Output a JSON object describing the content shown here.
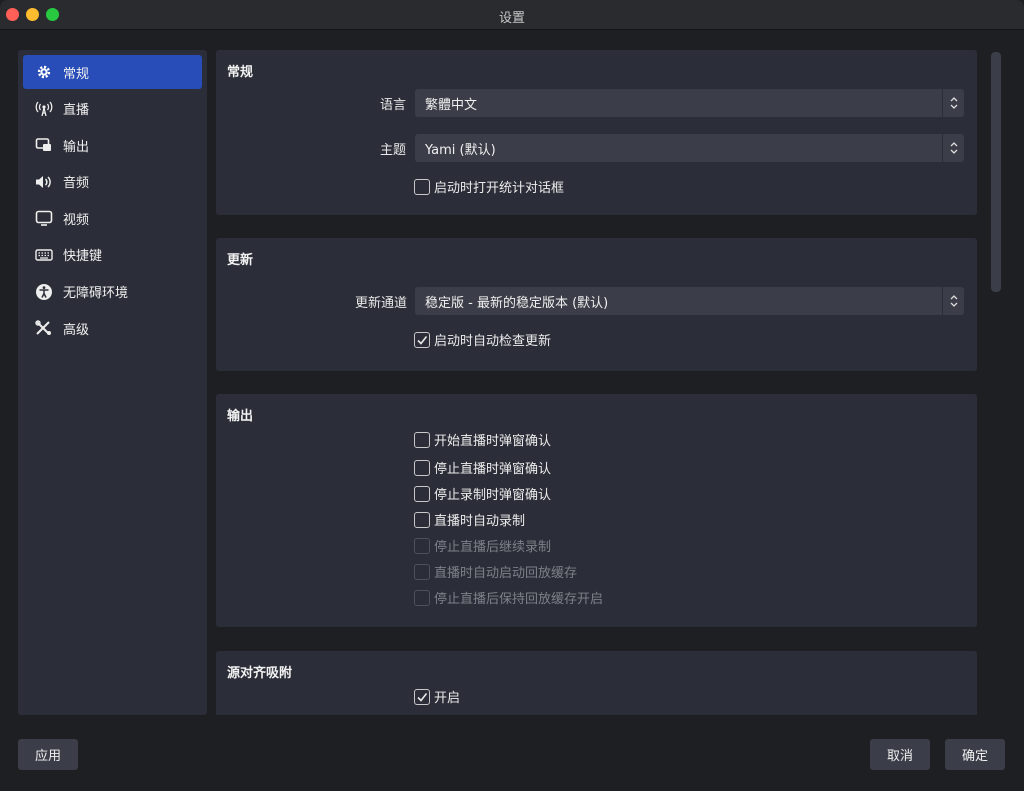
{
  "window": {
    "title": "设置"
  },
  "sidebar": {
    "items": [
      {
        "label": "常规",
        "icon": "gear-icon"
      },
      {
        "label": "直播",
        "icon": "antenna-icon"
      },
      {
        "label": "输出",
        "icon": "output-icon"
      },
      {
        "label": "音频",
        "icon": "speaker-icon"
      },
      {
        "label": "视频",
        "icon": "monitor-icon"
      },
      {
        "label": "快捷键",
        "icon": "keyboard-icon"
      },
      {
        "label": "无障碍环境",
        "icon": "accessibility-icon"
      },
      {
        "label": "高级",
        "icon": "tools-icon"
      }
    ],
    "active_index": 0
  },
  "general": {
    "title": "常规",
    "language_label": "语言",
    "language_value": "繁體中文",
    "theme_label": "主题",
    "theme_value": "Yami (默认)",
    "open_stats_label": "启动时打开统计对话框",
    "open_stats_checked": false
  },
  "update": {
    "title": "更新",
    "channel_label": "更新通道",
    "channel_value": "稳定版 - 最新的稳定版本 (默认)",
    "auto_check_label": "启动时自动检查更新",
    "auto_check_checked": true
  },
  "output": {
    "title": "输出",
    "options": [
      {
        "label": "开始直播时弹窗确认",
        "checked": false,
        "disabled": false
      },
      {
        "label": "停止直播时弹窗确认",
        "checked": false,
        "disabled": false
      },
      {
        "label": "停止录制时弹窗确认",
        "checked": false,
        "disabled": false
      },
      {
        "label": "直播时自动录制",
        "checked": false,
        "disabled": false
      },
      {
        "label": "停止直播后继续录制",
        "checked": false,
        "disabled": true
      },
      {
        "label": "直播时自动启动回放缓存",
        "checked": false,
        "disabled": true
      },
      {
        "label": "停止直播后保持回放缓存开启",
        "checked": false,
        "disabled": true
      }
    ]
  },
  "snapping": {
    "title": "源对齐吸附",
    "enable_label": "开启",
    "enable_checked": true
  },
  "footer": {
    "apply_label": "应用",
    "cancel_label": "取消",
    "ok_label": "确定"
  },
  "colors": {
    "accent": "#284cb8",
    "panel": "#2b2e38",
    "background": "#1e1f23",
    "control": "#3b3e48"
  }
}
